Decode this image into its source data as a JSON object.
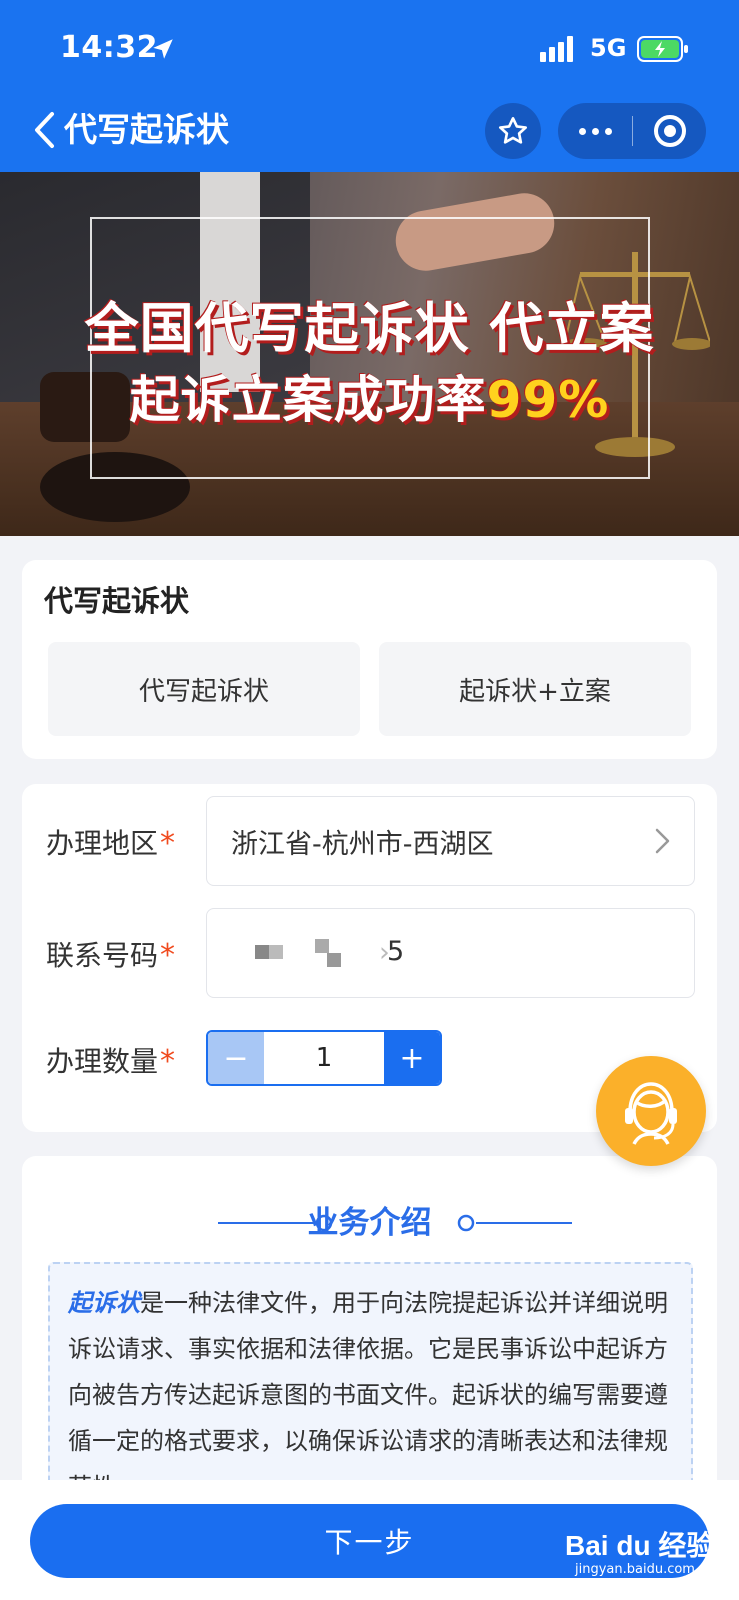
{
  "status_bar": {
    "time": "14:32",
    "network": "5G"
  },
  "nav": {
    "title": "代写起诉状"
  },
  "banner": {
    "line1": "全国代写起诉状 代立案",
    "line2_prefix": "起诉立案成功率",
    "line2_highlight": "99%"
  },
  "service": {
    "title": "代写起诉状",
    "options": [
      "代写起诉状",
      "起诉状+立案"
    ]
  },
  "form": {
    "region_label": "办理地区",
    "region_value": "浙江省-杭州市-西湖区",
    "phone_label": "联系号码",
    "phone_value": "5",
    "quantity_label": "办理数量",
    "quantity_value": "1",
    "required_mark": "*",
    "minus": "−",
    "plus": "+"
  },
  "intro": {
    "title": "业务介绍",
    "keyword": "起诉状",
    "text": "是一种法律文件，用于向法院提起诉讼并详细说明诉讼请求、事实依据和法律依据。它是民事诉讼中起诉方向被告方传达起诉意图的书面文件。起诉状的编写需要遵循一定的格式要求，以确保诉讼请求的清晰表达和法律规范性。"
  },
  "footer": {
    "next_label": "下一步"
  },
  "watermark": {
    "main": "Bai du 经验",
    "sub": "jingyan.baidu.com"
  },
  "colors": {
    "primary": "#1a73f0",
    "required": "#f04a1e",
    "support": "#fbb02a"
  }
}
